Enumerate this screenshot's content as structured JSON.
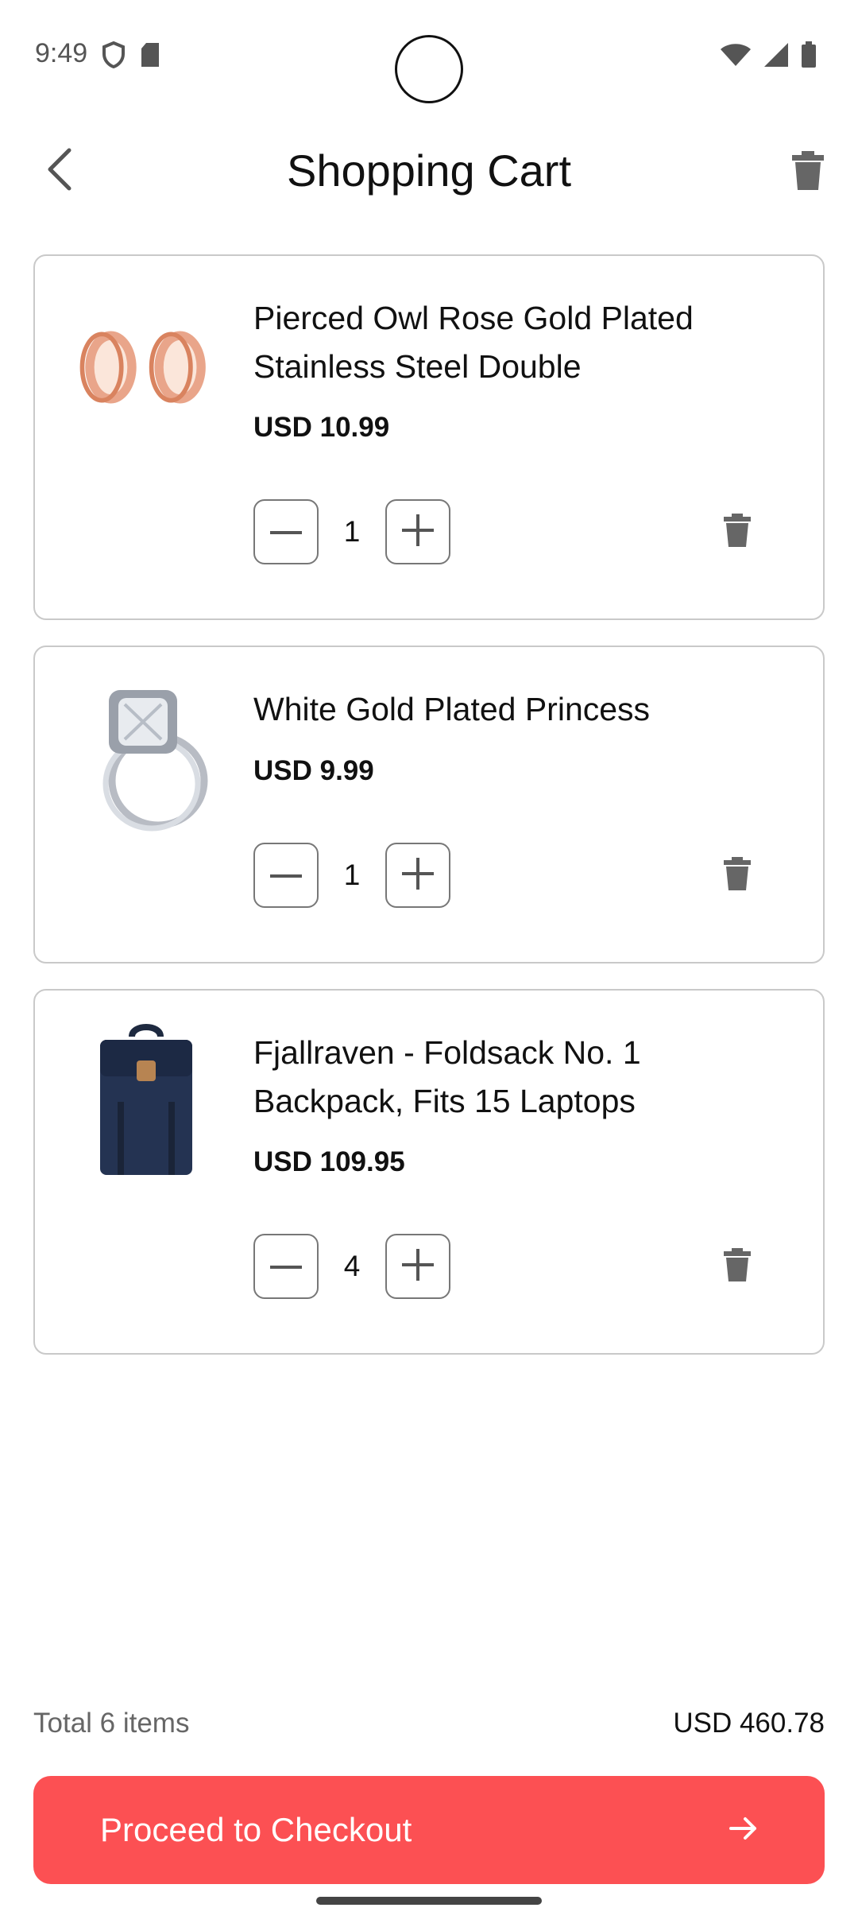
{
  "status_bar": {
    "time": "9:49",
    "left_icons": [
      "shield-icon",
      "sd-card-icon"
    ],
    "right_icons": [
      "wifi-icon",
      "cell-signal-icon",
      "battery-icon"
    ]
  },
  "header": {
    "title": "Shopping Cart",
    "back_icon": "chevron-left-icon",
    "clear_icon": "trash-icon"
  },
  "cart": {
    "items": [
      {
        "name": "Pierced Owl Rose Gold Plated Stainless Steel Double",
        "price": "USD 10.99",
        "quantity": "1",
        "image": "rose-gold-plugs"
      },
      {
        "name": "White Gold Plated Princess",
        "price": "USD 9.99",
        "quantity": "1",
        "image": "diamond-ring"
      },
      {
        "name": "Fjallraven - Foldsack No. 1 Backpack, Fits 15 Laptops",
        "price": "USD 109.95",
        "quantity": "4",
        "image": "navy-backpack"
      }
    ]
  },
  "summary": {
    "total_label": "Total 6 items",
    "total_value": "USD 460.78"
  },
  "checkout": {
    "label": "Proceed to Checkout",
    "icon": "arrow-right-icon"
  },
  "colors": {
    "accent": "#fc5053",
    "border": "#c9c9c9",
    "icon_gray": "#666666"
  }
}
